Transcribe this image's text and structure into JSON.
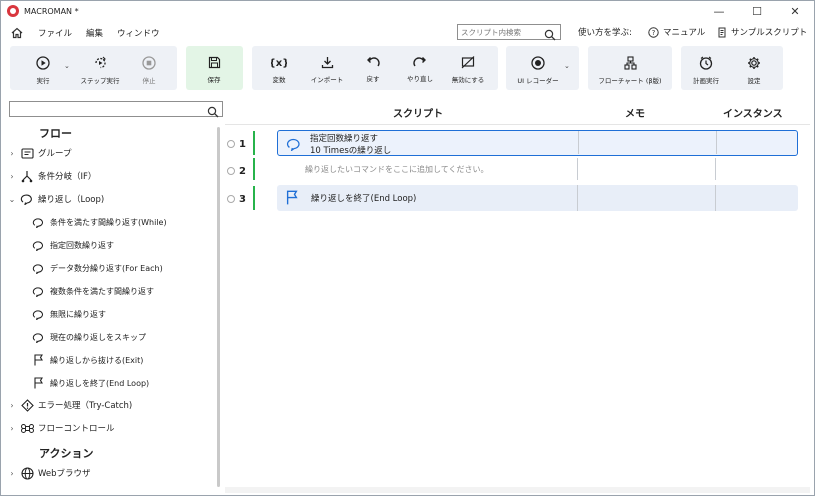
{
  "window": {
    "title": "MACROMAN *",
    "minimize": "—",
    "maximize": "☐",
    "close": "✕"
  },
  "menu": {
    "items": [
      "ファイル",
      "編集",
      "ウィンドウ"
    ]
  },
  "search": {
    "placeholder": "スクリプト内検索"
  },
  "help": {
    "learn": "使い方を学ぶ:",
    "manual": "マニュアル",
    "samples": "サンプルスクリプト"
  },
  "toolbar": {
    "run": "実行",
    "step": "ステップ実行",
    "stop": "停止",
    "save": "保存",
    "variables": "変数",
    "import": "インポート",
    "undo": "戻す",
    "redo": "やり直し",
    "disable": "無効にする",
    "ui_recorder": "UI レコーダー",
    "flowchart": "フローチャート (β版)",
    "schedule": "計画実行",
    "settings": "設定"
  },
  "sidebar": {
    "flow_section": "フロー",
    "group": "グループ",
    "if": "条件分岐（IF）",
    "loop": "繰り返し（Loop)",
    "loop_items": [
      "条件を満たす間繰り返す(While)",
      "指定回数繰り返す",
      "データ数分繰り返す(For Each)",
      "複数条件を満たす間繰り返す",
      "無限に繰り返す",
      "現在の繰り返しをスキップ",
      "繰り返しから抜ける(Exit)",
      "繰り返しを終了(End Loop)"
    ],
    "trycatch": "エラー処理（Try-Catch)",
    "flowcontrol": "フローコントロール",
    "action_section": "アクション",
    "browser": "Webブラウザ"
  },
  "main": {
    "headers": {
      "script": "スクリプト",
      "memo": "メモ",
      "instance": "インスタンス"
    },
    "lines": [
      "1",
      "2",
      "3"
    ],
    "row1_title": "指定回数繰り返す",
    "row1_sub": "10 Timesの繰り返し",
    "row2_placeholder": "繰り返したいコマンドをここに追加してください。",
    "row3_title": "繰り返しを終了(End Loop)"
  },
  "colors": {
    "accent": "#1f6fd6",
    "save_bg": "#e3f5e6",
    "group_bg": "#eef1f6",
    "line_green": "#27b34b",
    "logo": "#d9363e"
  }
}
